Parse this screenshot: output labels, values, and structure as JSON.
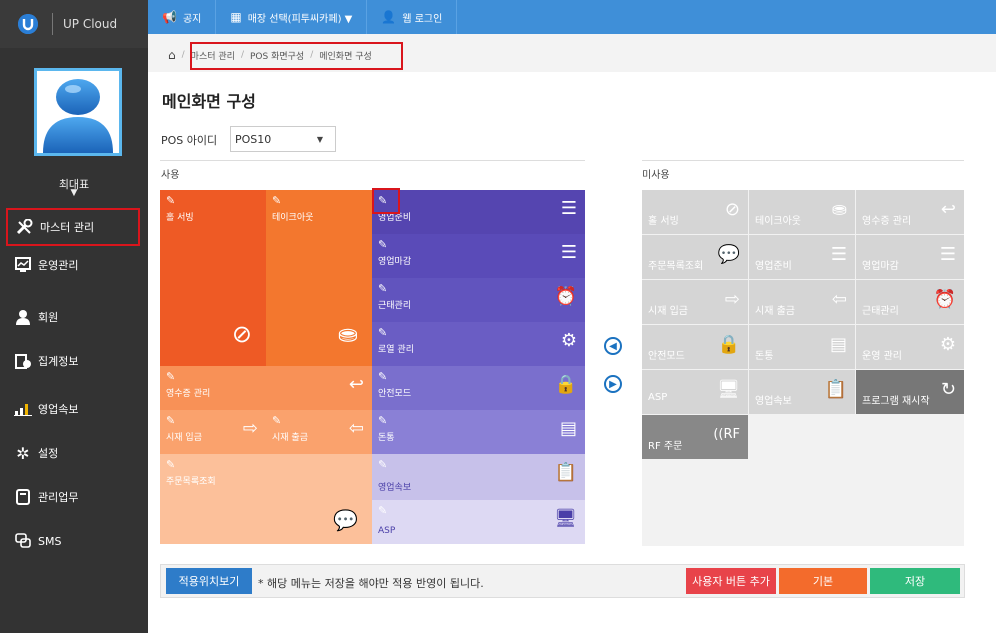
{
  "brand": {
    "name": "UP Cloud"
  },
  "user": {
    "name": "최대표",
    "caret": "▼"
  },
  "sidebar": {
    "items": [
      {
        "label": "마스터 관리",
        "icon": "tools-icon"
      },
      {
        "label": "운영관리",
        "icon": "monitor-icon"
      },
      {
        "label": "회원",
        "icon": "user-icon"
      },
      {
        "label": "집계정보",
        "icon": "report-icon"
      },
      {
        "label": "영업속보",
        "icon": "chart-icon"
      },
      {
        "label": "설정",
        "icon": "gear-icon"
      },
      {
        "label": "관리업무",
        "icon": "tablet-icon"
      },
      {
        "label": "SMS",
        "icon": "chat-icon"
      }
    ]
  },
  "topbar": {
    "notice": "공지",
    "store": "매장 선택(피투씨카페) ▼",
    "login": "웹 로그인"
  },
  "breadcrumb": {
    "home": "⌂",
    "sep": "/",
    "l1": "마스터 관리",
    "l2": "POS 화면구성",
    "l3": "메인화면 구성"
  },
  "page": {
    "title": "메인화면 구성",
    "pos_label": "POS 아이디",
    "pos_value": "POS10",
    "used": "사용",
    "unused": "미사용"
  },
  "used_tiles": {
    "t1": "홀 서빙",
    "t2": "테이크아웃",
    "t3": "영업준비",
    "t4": "영업마감",
    "t5": "근태관리",
    "t6": "로열 관리",
    "t7": "영수증 관리",
    "t8": "안전모드",
    "t9": "시재 입금",
    "t10": "시재 출금",
    "t11": "돈통",
    "t12": "주문목록조회",
    "t13": "영업속보",
    "t14": "ASP"
  },
  "unused_tiles": {
    "u1": "홀 서빙",
    "u2": "테이크아웃",
    "u3": "영수증 관리",
    "u4": "주문목록조회",
    "u5": "영업준비",
    "u6": "영업마감",
    "u7": "시재 입금",
    "u8": "시재 출금",
    "u9": "근태관리",
    "u10": "안전모드",
    "u11": "돈통",
    "u12": "운영 관리",
    "u13": "ASP",
    "u14": "영업속보",
    "u15": "프로그램 재시작",
    "u16": "RF 주문"
  },
  "bottom": {
    "preview": "적용위치보기",
    "note": "* 해당 메뉴는 저장을 해야만 적용 반영이 됩니다.",
    "add": "사용자 버튼 추가",
    "default": "기본",
    "save": "저장"
  },
  "colors": {
    "primary": "#3f8fd8",
    "red": "#e8434a",
    "orange": "#f36b2c",
    "green": "#2fba7c",
    "purple": "#5a4bb8"
  }
}
